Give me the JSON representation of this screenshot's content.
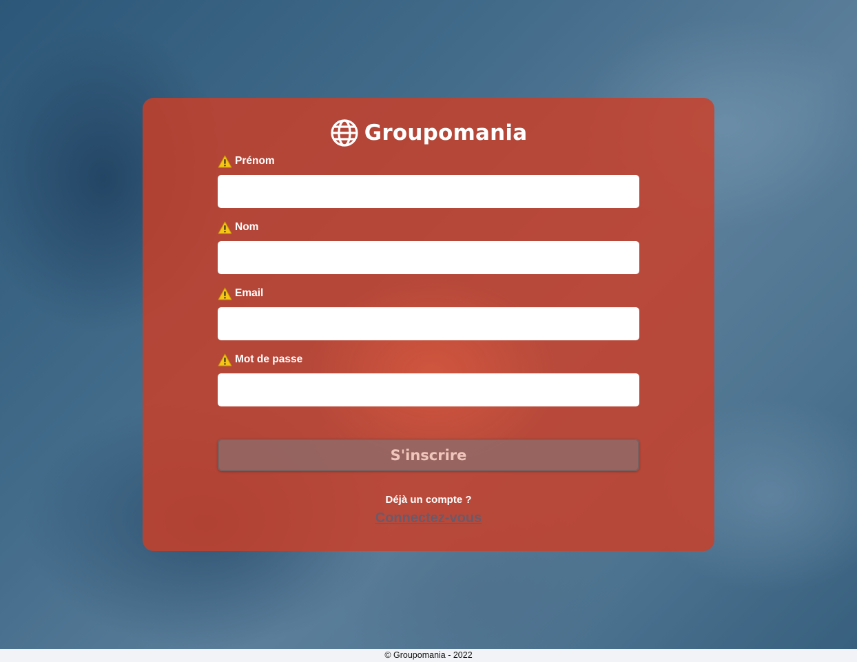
{
  "brand": {
    "name": "Groupomania",
    "icon": "globe-icon"
  },
  "form": {
    "fields": [
      {
        "label": "Prénom",
        "value": "",
        "icon": "warning-icon"
      },
      {
        "label": "Nom",
        "value": "",
        "icon": "warning-icon"
      },
      {
        "label": "Email",
        "value": "",
        "icon": "warning-icon"
      },
      {
        "label": "Mot de passe",
        "value": "",
        "icon": "warning-icon"
      }
    ],
    "submit_label": "S'inscrire"
  },
  "login": {
    "prompt": "Déjà un compte ?",
    "link_label": "Connectez-vous"
  },
  "footer": {
    "text": "© Groupomania - 2022"
  },
  "colors": {
    "card": "#cd3e26",
    "warning": "#f5c518",
    "link": "#6a5a6a"
  }
}
